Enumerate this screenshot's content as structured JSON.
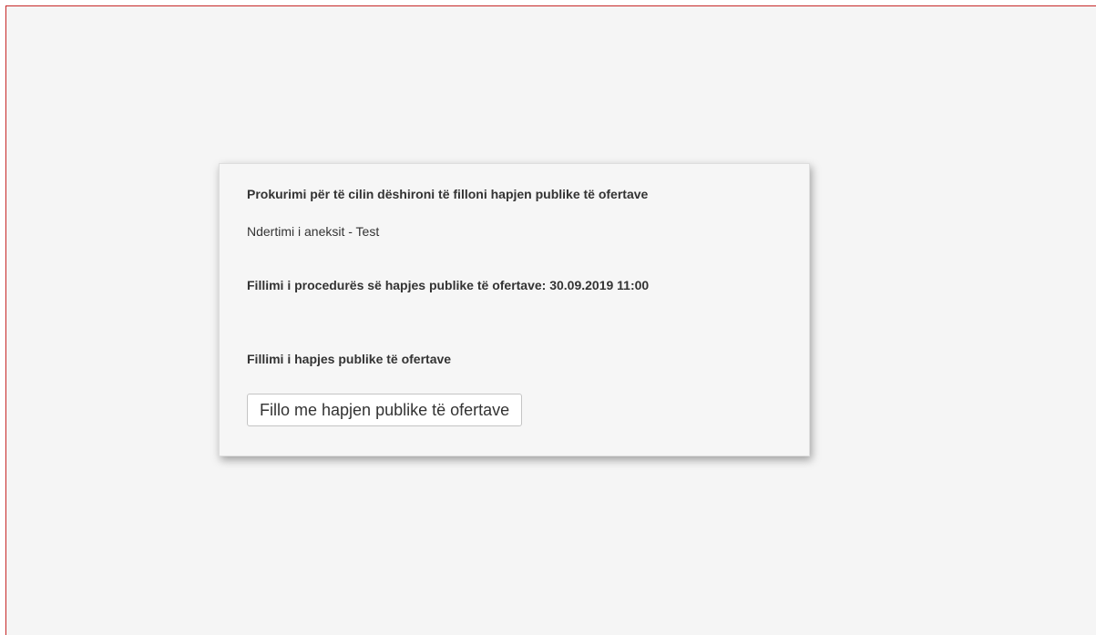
{
  "panel": {
    "procurement_label": "Prokurimi për të cilin dëshironi të filloni hapjen publike të ofertave",
    "procurement_name": "Ndertimi i aneksit - Test",
    "procedure_start_label": "Fillimi i procedurës së hapjes publike të ofertave: 30.09.2019 11:00",
    "opening_heading": "Fillimi i hapjes publike të ofertave",
    "start_button_label": "Fillo me hapjen publike të ofertave"
  },
  "colors": {
    "frame_border": "#c62828",
    "background": "#f5f5f5",
    "text": "#333333"
  }
}
